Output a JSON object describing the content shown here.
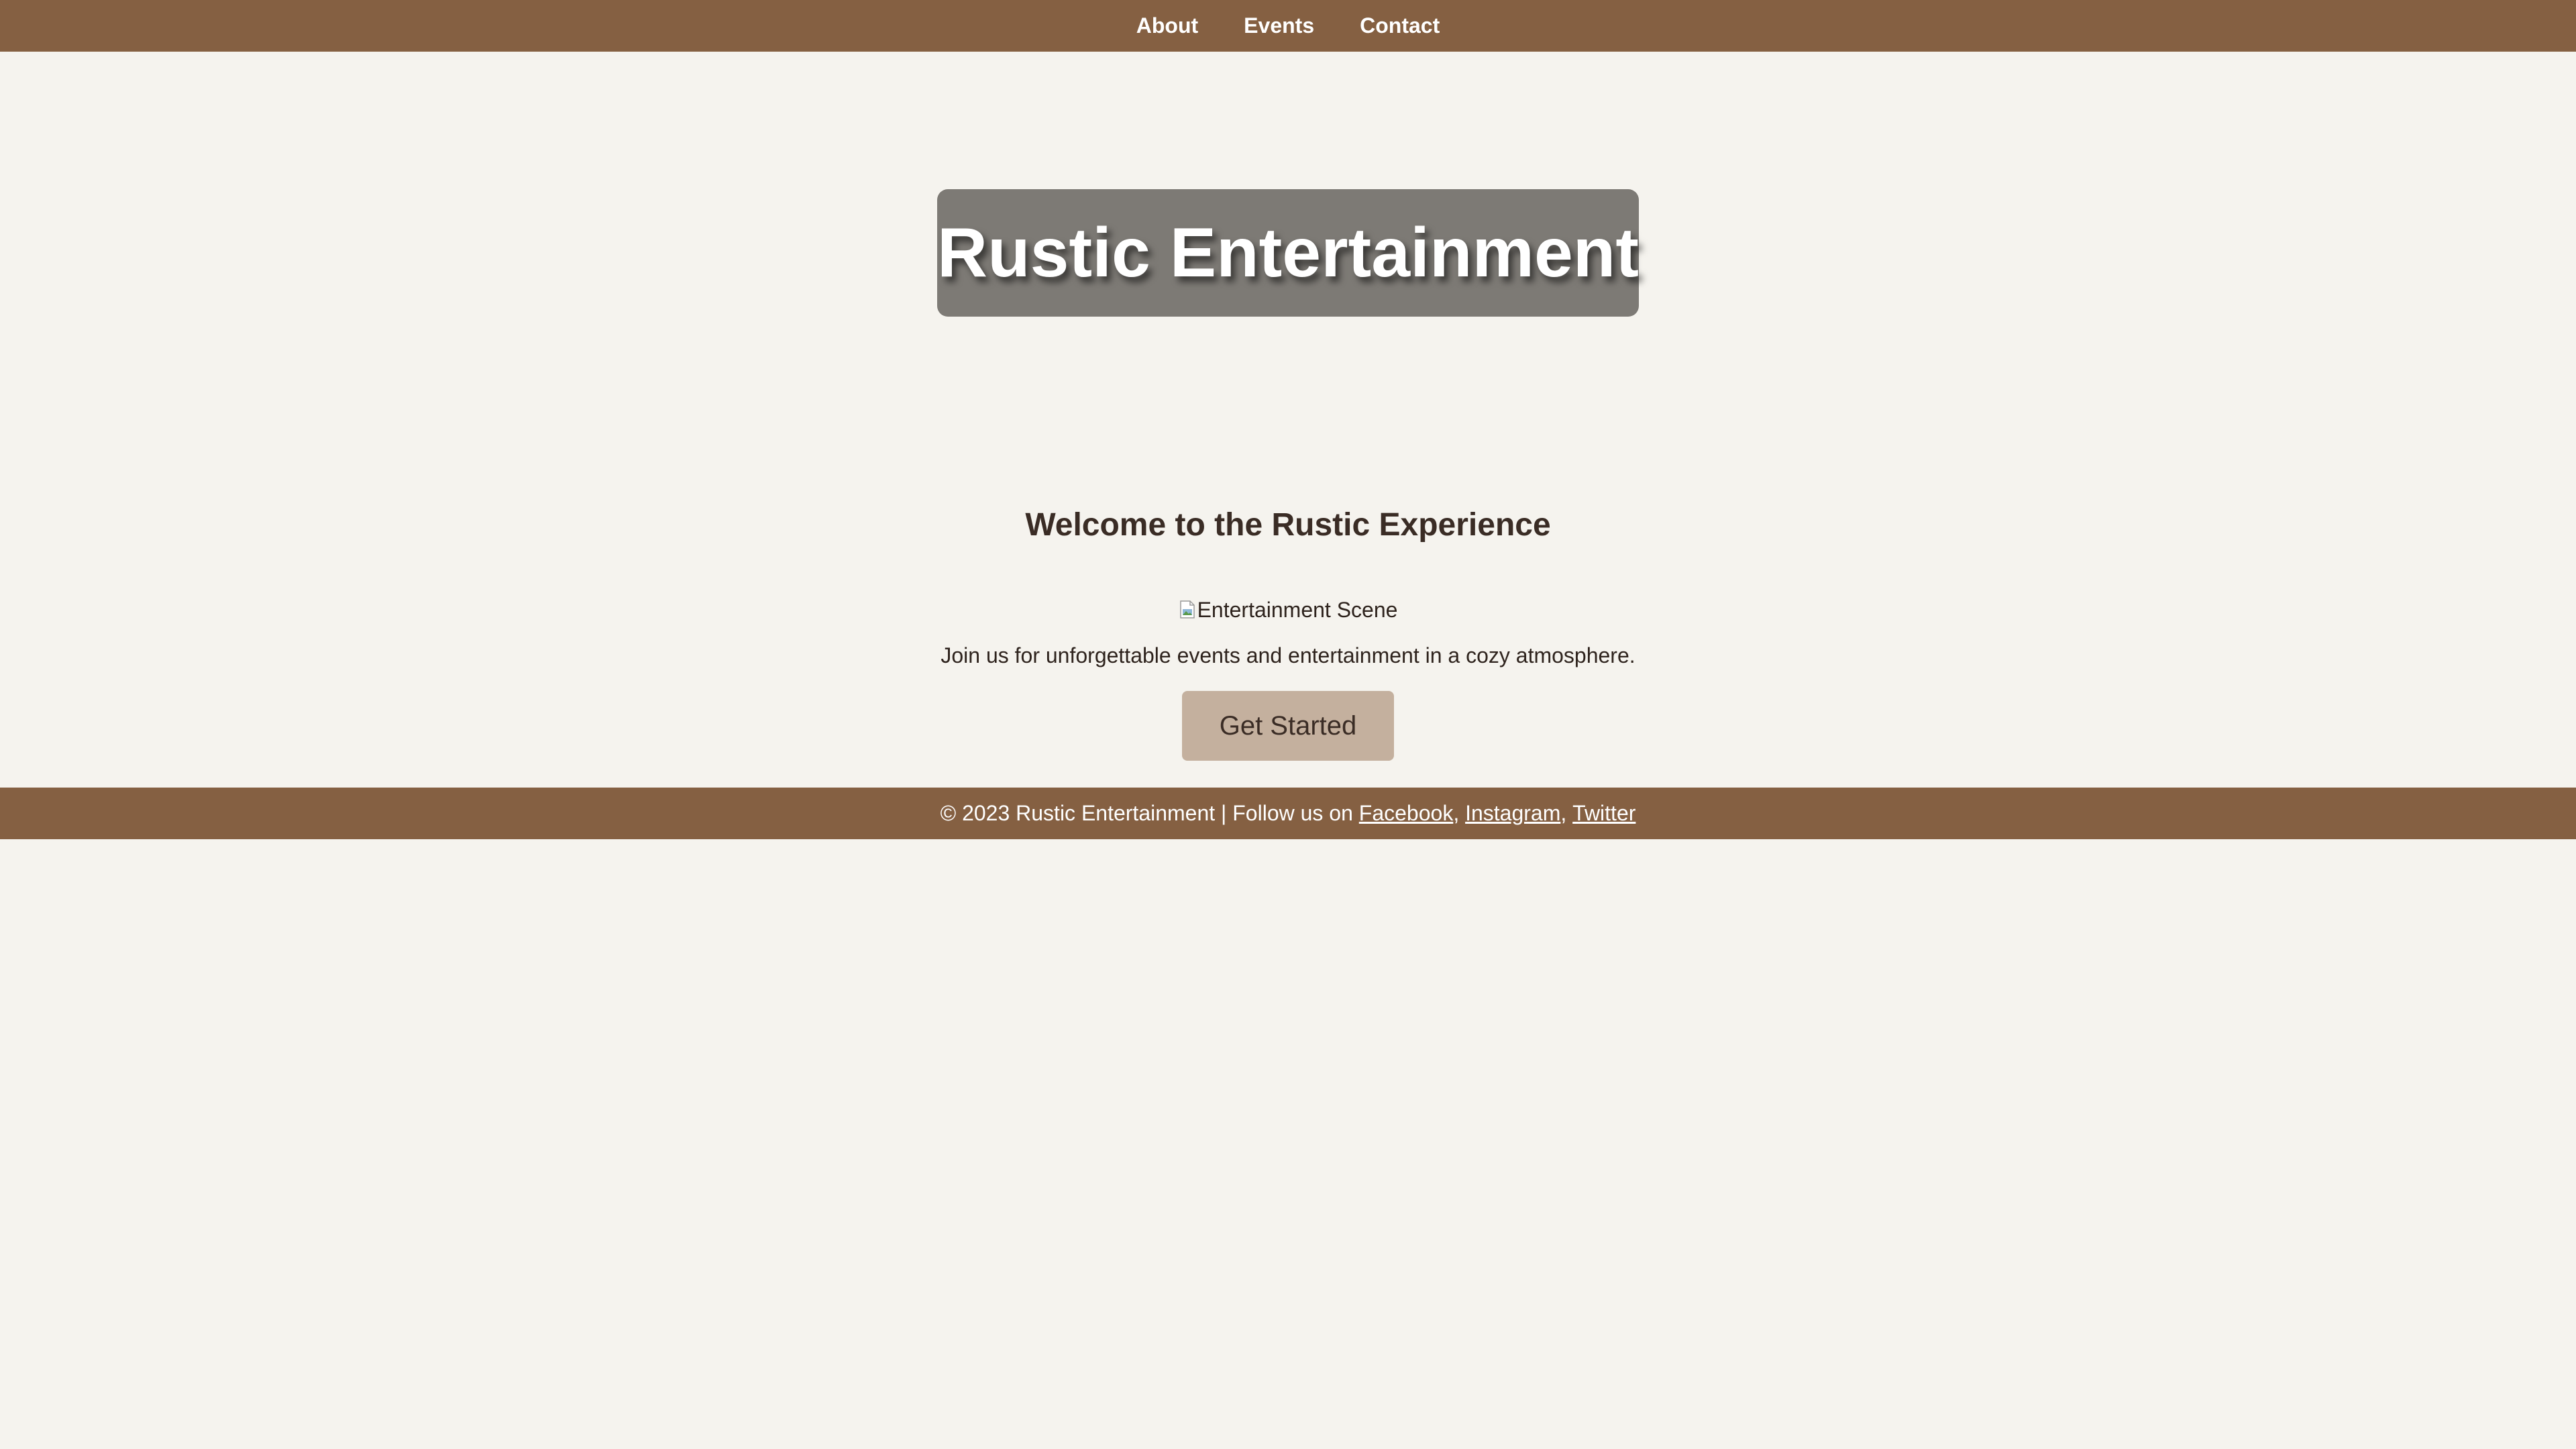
{
  "nav": {
    "items": [
      {
        "label": "About"
      },
      {
        "label": "Events"
      },
      {
        "label": "Contact"
      }
    ]
  },
  "hero": {
    "title": "Rustic Entertainment"
  },
  "welcome": {
    "heading": "Welcome to the Rustic Experience",
    "image_alt": "Entertainment Scene",
    "text": "Join us for unforgettable events and entertainment in a cozy atmosphere.",
    "cta_label": "Get Started"
  },
  "footer": {
    "prefix": "© 2023 Rustic Entertainment | Follow us on ",
    "links": [
      {
        "label": "Facebook"
      },
      {
        "label": "Instagram"
      },
      {
        "label": "Twitter"
      }
    ],
    "separator": ", "
  },
  "colors": {
    "nav_bg": "#856042",
    "page_bg": "#f5f3ee",
    "hero_box_bg": "#7d7a75",
    "button_bg": "#c4b09e",
    "text_dark": "#3a2c25"
  }
}
